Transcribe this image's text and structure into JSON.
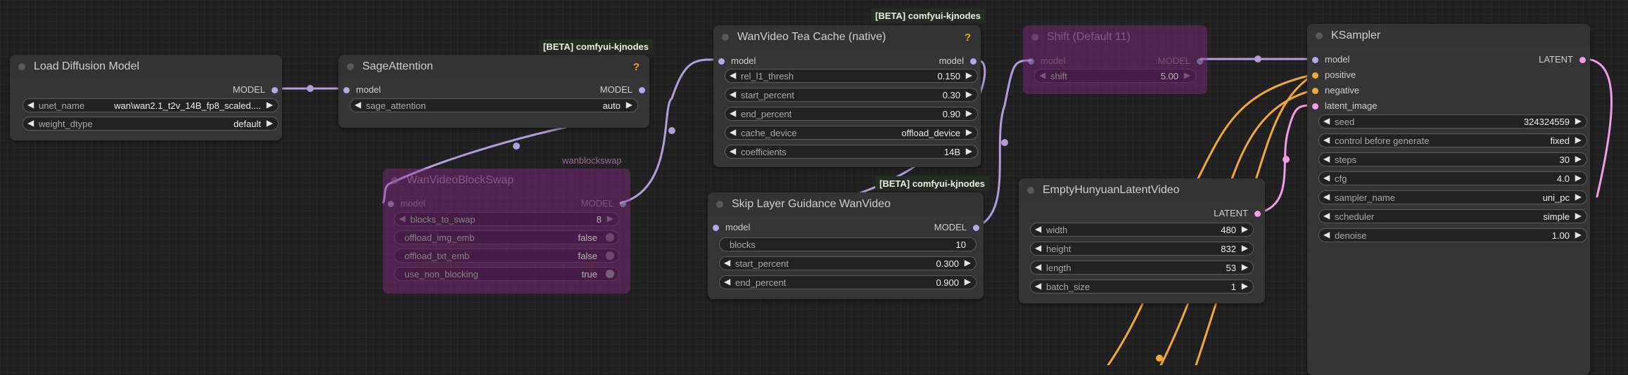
{
  "nodes": {
    "load_diffusion": {
      "title": "Load Diffusion Model",
      "out": "MODEL",
      "widgets": [
        {
          "label": "unet_name",
          "value": "wan\\wan2.1_t2v_14B_fp8_scaled...."
        },
        {
          "label": "weight_dtype",
          "value": "default"
        }
      ]
    },
    "sage": {
      "title": "SageAttention",
      "badge": "[BETA] comfyui-kjnodes",
      "help": "?",
      "in": "model",
      "out": "MODEL",
      "widgets": [
        {
          "label": "sage_attention",
          "value": "auto"
        }
      ]
    },
    "blockswap": {
      "title": "WanVideoBlockSwap",
      "badge": "wanblockswap",
      "in": "model",
      "out": "MODEL",
      "widgets": [
        {
          "label": "blocks_to_swap",
          "value": "8"
        },
        {
          "label": "offload_img_emb",
          "value": "false"
        },
        {
          "label": "offload_txt_emb",
          "value": "false"
        },
        {
          "label": "use_non_blocking",
          "value": "true"
        }
      ]
    },
    "teacache": {
      "title": "WanVideo Tea Cache (native)",
      "badge": "[BETA] comfyui-kjnodes",
      "help": "?",
      "in": "model",
      "out": "model",
      "widgets": [
        {
          "label": "rel_l1_thresh",
          "value": "0.150"
        },
        {
          "label": "start_percent",
          "value": "0.30"
        },
        {
          "label": "end_percent",
          "value": "0.90"
        },
        {
          "label": "cache_device",
          "value": "offload_device"
        },
        {
          "label": "coefficients",
          "value": "14B"
        }
      ]
    },
    "slg": {
      "title": "Skip Layer Guidance WanVideo",
      "badge": "[BETA] comfyui-kjnodes",
      "in": "model",
      "out": "MODEL",
      "widgets": [
        {
          "label": "blocks",
          "value": "10"
        },
        {
          "label": "start_percent",
          "value": "0.300"
        },
        {
          "label": "end_percent",
          "value": "0.900"
        }
      ]
    },
    "shift": {
      "title": "Shift (Default 11)",
      "in": "model",
      "out": "MODEL",
      "widgets": [
        {
          "label": "shift",
          "value": "5.00"
        }
      ]
    },
    "latent": {
      "title": "EmptyHunyuanLatentVideo",
      "out": "LATENT",
      "widgets": [
        {
          "label": "width",
          "value": "480"
        },
        {
          "label": "height",
          "value": "832"
        },
        {
          "label": "length",
          "value": "53"
        },
        {
          "label": "batch_size",
          "value": "1"
        }
      ]
    },
    "ksampler": {
      "title": "KSampler",
      "out": "LATENT",
      "inputs": [
        "model",
        "positive",
        "negative",
        "latent_image"
      ],
      "widgets": [
        {
          "label": "seed",
          "value": "324324559"
        },
        {
          "label": "control before generate",
          "value": "fixed"
        },
        {
          "label": "steps",
          "value": "30"
        },
        {
          "label": "cfg",
          "value": "4.0"
        },
        {
          "label": "sampler_name",
          "value": "uni_pc"
        },
        {
          "label": "scheduler",
          "value": "simple"
        },
        {
          "label": "denoise",
          "value": "1.00"
        }
      ]
    }
  },
  "link_colors": {
    "model": "#b39ddb",
    "conditioning": "#f3a93a",
    "latent": "#f29be8"
  }
}
